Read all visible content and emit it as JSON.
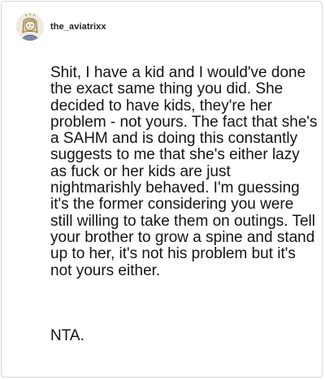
{
  "comment": {
    "username": "the_aviatrixx",
    "body": "Shit, I have a kid and I would've done the exact same thing you did. She decided to have kids, they're her problem - not yours. The fact that she's a SAHM and is doing this constantly suggests to me that she's either lazy as fuck or her kids are just nightmarishly behaved. I'm guessing it's the former considering you were still willing to take them on outings. Tell your brother to grow a spine and stand up to her, it's not his problem but it's not yours either.",
    "verdict": "NTA."
  }
}
